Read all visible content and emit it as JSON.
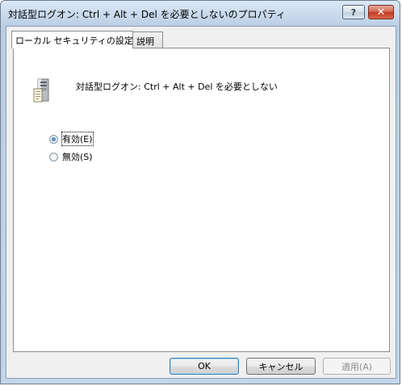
{
  "window": {
    "title": "対話型ログオン: Ctrl + Alt + Del を必要としないのプロパティ",
    "help_label": "?",
    "close_label": "✕"
  },
  "tabs": [
    {
      "label": "ローカル セキュリティの設定",
      "active": true
    },
    {
      "label": "説明",
      "active": false
    }
  ],
  "policy": {
    "icon": "server-policy-icon",
    "description": "対話型ログオン: Ctrl + Alt + Del を必要としない"
  },
  "options": [
    {
      "label": "有効(E)",
      "checked": true
    },
    {
      "label": "無効(S)",
      "checked": false
    }
  ],
  "buttons": {
    "ok": "OK",
    "cancel": "キャンセル",
    "apply": "適用(A)"
  }
}
